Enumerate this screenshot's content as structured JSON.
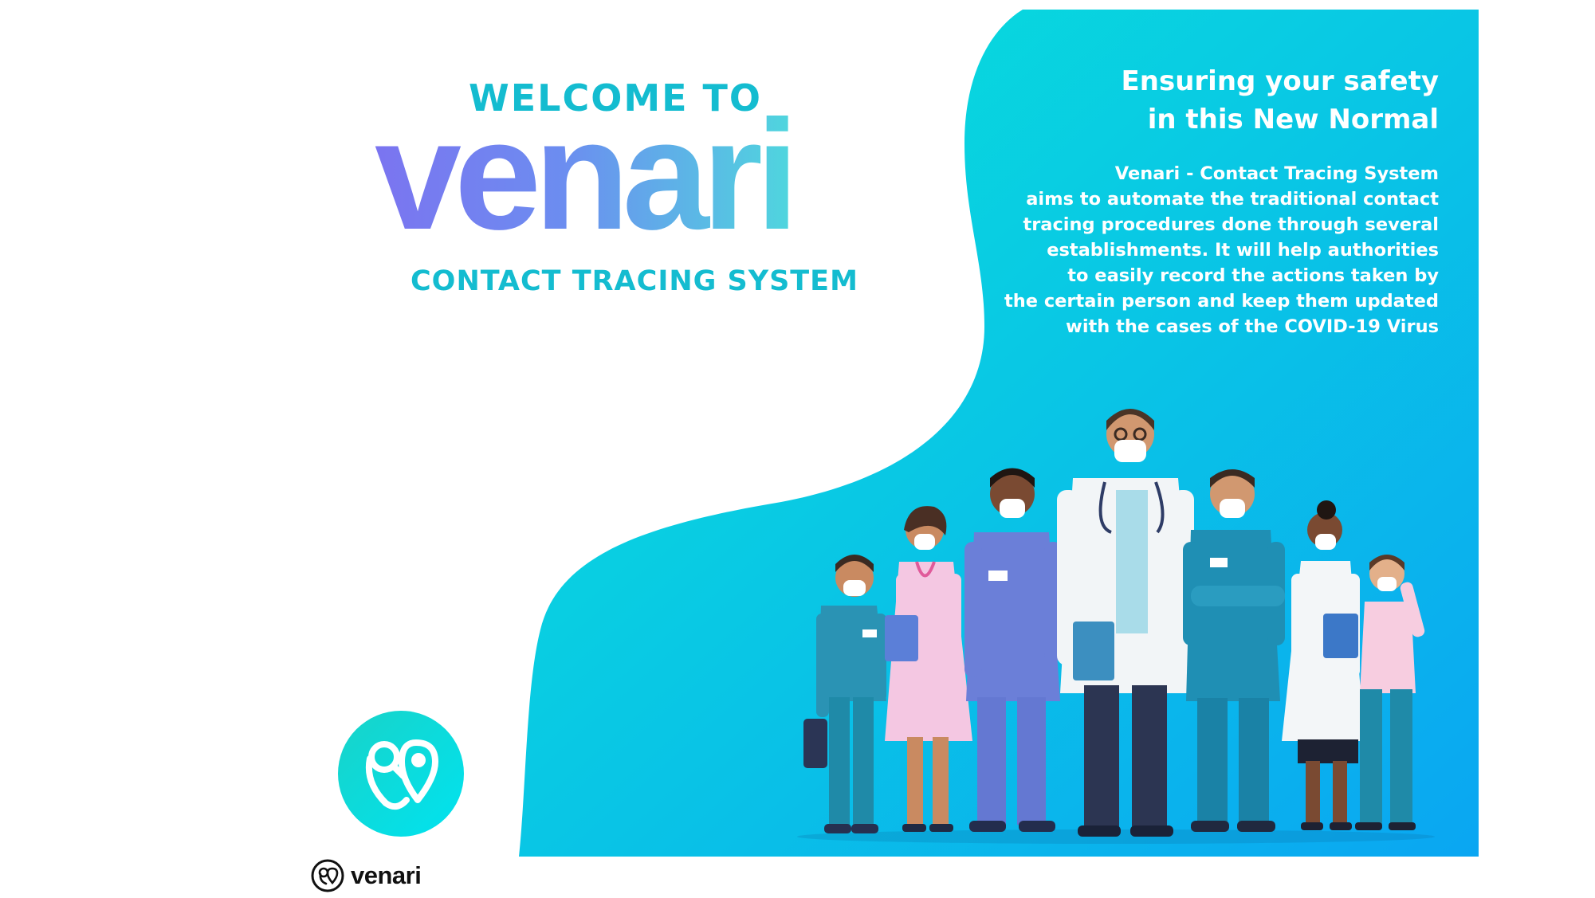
{
  "welcome": "WELCOME TO",
  "brand": "venari",
  "subtitle": "CONTACT TRACING SYSTEM",
  "tagline": [
    "Ensuring your safety",
    "in this New Normal"
  ],
  "description": [
    "Venari - Contact Tracing System",
    "aims to automate the traditional contact",
    "tracing procedures done through several",
    "establishments. It will help authorities",
    "to easily record the actions taken by",
    "the certain person and keep them updated",
    "with the cases of the COVID-19 Virus"
  ],
  "footer_brand": "venari",
  "icons": {
    "app": "venari-app-icon",
    "footer": "venari-logo-icon",
    "illustration": "healthcare-workers-illustration"
  },
  "colors": {
    "accent": "#14bcd0",
    "panel_start": "#08e6d8",
    "panel_end": "#0aa6f2"
  }
}
